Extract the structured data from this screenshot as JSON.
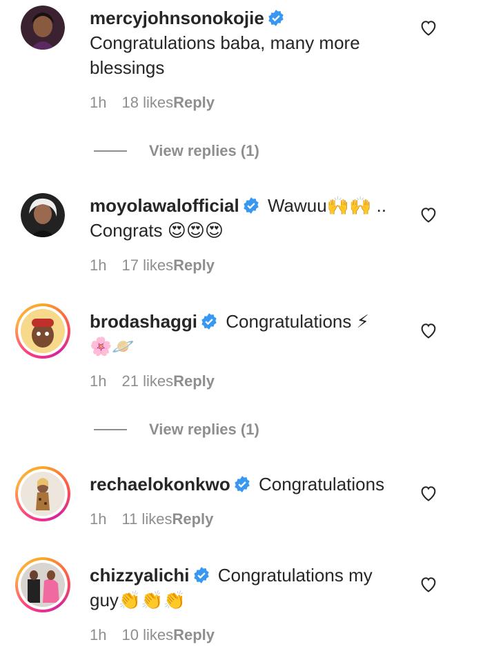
{
  "colors": {
    "text": "#262626",
    "muted": "#8e8e8e",
    "verified": "#3897f0"
  },
  "comments": [
    {
      "username": "mercyjohnsonokojie",
      "verified": true,
      "text_line1": "Congratulations baba, many more",
      "text_line2": "blessings",
      "time": "1h",
      "likes": "18 likes",
      "reply": "Reply",
      "view_replies": "View replies (1)"
    },
    {
      "username": "moyolawalofficial",
      "verified": true,
      "text_line1": "Wawuu🙌🙌 ..",
      "text_line2": "Congrats 😍😍😍",
      "time": "1h",
      "likes": "17 likes",
      "reply": "Reply"
    },
    {
      "username": "brodashaggi",
      "verified": true,
      "text_line1": "Congratulations ⚡",
      "text_line2": "🌸🪐",
      "time": "1h",
      "likes": "21 likes",
      "reply": "Reply",
      "view_replies": "View replies (1)"
    },
    {
      "username": "rechaelokonkwo",
      "verified": true,
      "text_line1": "Congratulations",
      "time": "1h",
      "likes": "11 likes",
      "reply": "Reply"
    },
    {
      "username": "chizzyalichi",
      "verified": true,
      "text_line1": "Congratulations my",
      "text_line2": "guy👏👏👏",
      "time": "1h",
      "likes": "10 likes",
      "reply": "Reply"
    }
  ],
  "icons": {
    "like": "heart-icon",
    "verified": "verified-badge-icon"
  }
}
